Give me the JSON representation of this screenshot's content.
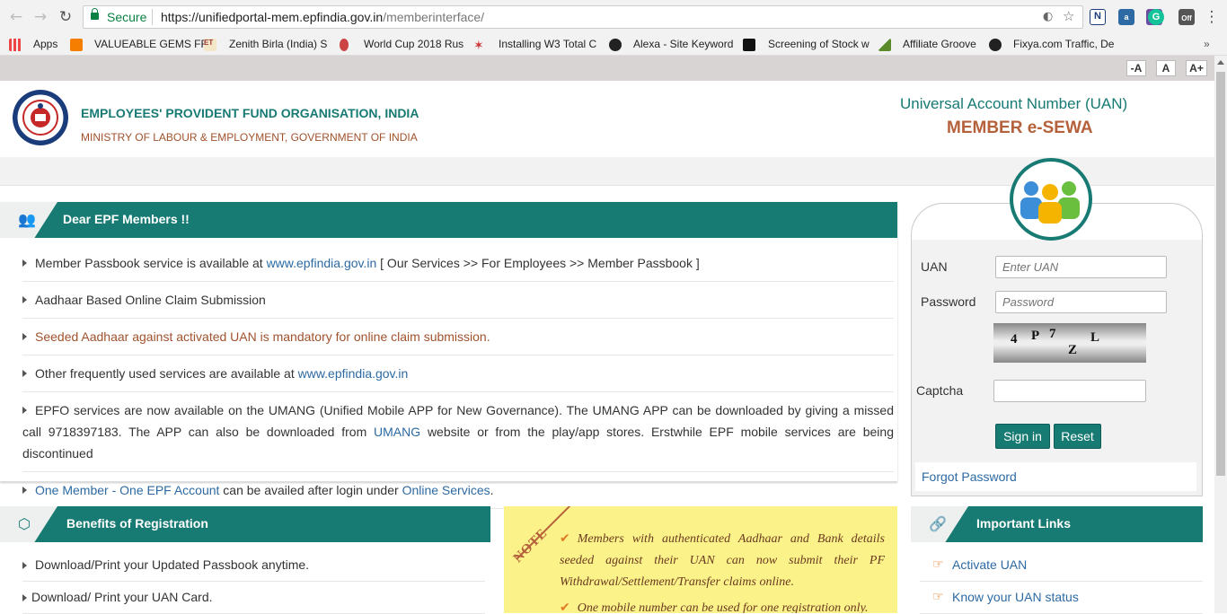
{
  "browser": {
    "secure_label": "Secure",
    "url_host": "https://unifiedportal-mem.epfindia.gov.in",
    "url_path": "/memberinterface/",
    "ext_off_badge": "Off"
  },
  "bookmarks": [
    {
      "label": "Apps"
    },
    {
      "label": "VALUEABLE GEMS FF"
    },
    {
      "label": "Zenith Birla (India) S"
    },
    {
      "label": "World Cup 2018 Rus"
    },
    {
      "label": "Installing W3 Total C"
    },
    {
      "label": "Alexa - Site Keyword"
    },
    {
      "label": "Screening of Stock w"
    },
    {
      "label": "Affiliate Groove"
    },
    {
      "label": "Fixya.com Traffic, De"
    }
  ],
  "font_controls": {
    "decrease": "-A",
    "normal": "A",
    "increase": "A+"
  },
  "header": {
    "org_name": "EMPLOYEES' PROVIDENT FUND ORGANISATION, INDIA",
    "ministry": "MINISTRY OF LABOUR & EMPLOYMENT, GOVERNMENT OF INDIA",
    "uan_title": "Universal Account Number (UAN)",
    "esewa": "MEMBER e-SEWA"
  },
  "members_panel": {
    "title": "Dear EPF Members !!",
    "item1_prefix": "Member Passbook service is available at ",
    "item1_link": "www.epfindia.gov.in",
    "item1_suffix": " [ Our Services >> For Employees >> Member Passbook ]",
    "item2": "Aadhaar Based Online Claim Submission",
    "item3": "Seeded Aadhaar against activated UAN is mandatory for online claim submission.",
    "item4_prefix": "Other frequently used services are available at ",
    "item4_link": "www.epfindia.gov.in",
    "item5_prefix": "EPFO services are now available on the UMANG (Unified Mobile APP for New Governance). The UMANG APP can be downloaded by giving a missed call 9718397183. The APP can also be downloaded from ",
    "item5_link": "UMANG",
    "item5_suffix": " website or from the play/app stores. Erstwhile EPF mobile services are being discontinued",
    "item6_link": "One Member - One EPF Account",
    "item6_mid": " can be availed after login under ",
    "item6_link2": "Online Services",
    "item6_end": "."
  },
  "login": {
    "uan_label": "UAN",
    "uan_placeholder": "Enter UAN",
    "password_label": "Password",
    "password_placeholder": "Password",
    "captcha_chars": [
      "4",
      "P",
      "7",
      "Z",
      "L"
    ],
    "captcha_label": "Captcha",
    "sign_in": "Sign in",
    "reset": "Reset",
    "forgot": "Forgot Password"
  },
  "benefits_panel": {
    "title": "Benefits of Registration",
    "items": [
      "Download/Print your Updated Passbook anytime.",
      "Download/ Print your UAN Card."
    ]
  },
  "note_panel": {
    "tag": "NOTE",
    "item1": "Members with authenticated Aadhaar and Bank details seeded against their UAN can now submit their PF Withdrawal/Settlement/Transfer claims online.",
    "item2": "One mobile number can be used for one registration only."
  },
  "links_panel": {
    "title": "Important Links",
    "items": [
      "Activate UAN",
      "Know your UAN status"
    ]
  },
  "colors": {
    "primary": "#177a73",
    "accent": "#b5613b",
    "link": "#2d6aa3",
    "note_bg": "#fbf28a"
  }
}
